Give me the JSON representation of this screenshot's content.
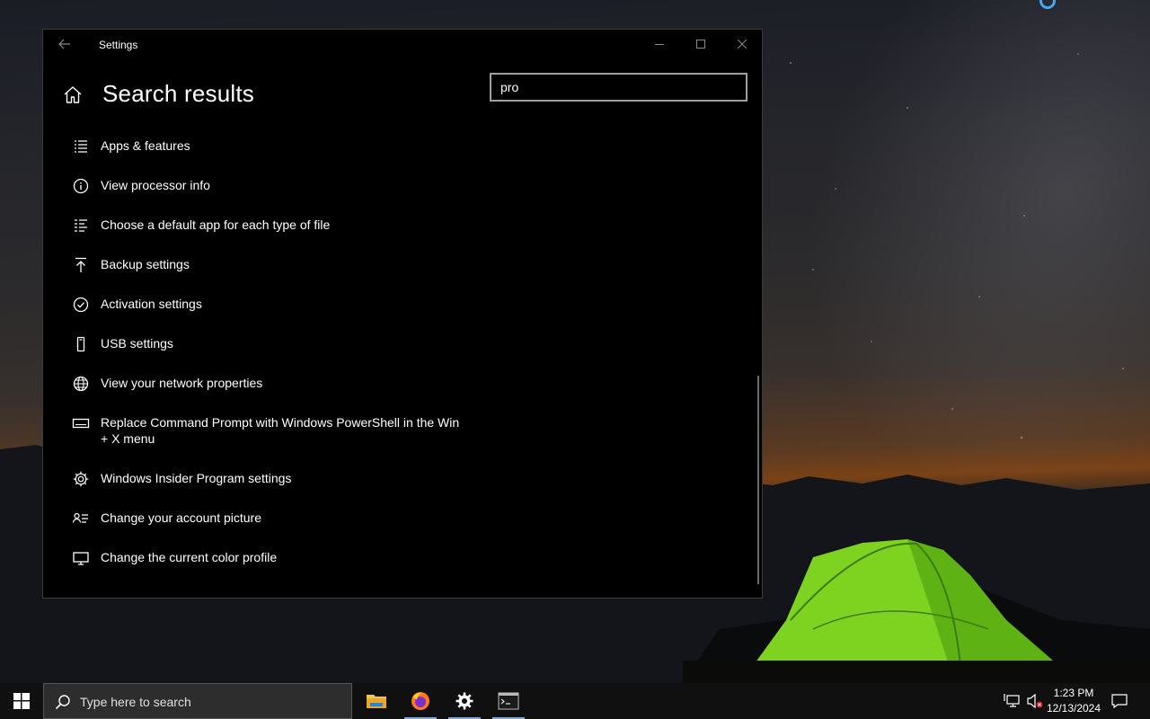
{
  "window": {
    "title": "Settings",
    "page_title": "Search results",
    "back_icon": "back-arrow-icon",
    "home_icon": "home-icon",
    "caption_buttons": [
      "minimize",
      "maximize",
      "close"
    ]
  },
  "search": {
    "value": "pro"
  },
  "results": [
    {
      "icon": "apps-list-icon",
      "label": "Apps & features"
    },
    {
      "icon": "info-icon",
      "label": "View processor info"
    },
    {
      "icon": "default-apps-icon",
      "label": "Choose a default app for each type of file"
    },
    {
      "icon": "backup-arrow-icon",
      "label": "Backup settings"
    },
    {
      "icon": "check-circle-icon",
      "label": "Activation settings"
    },
    {
      "icon": "usb-icon",
      "label": "USB settings"
    },
    {
      "icon": "globe-network-icon",
      "label": "View your network properties"
    },
    {
      "icon": "keyboard-icon",
      "label": "Replace Command Prompt with Windows PowerShell in the Win + X menu"
    },
    {
      "icon": "gear-icon",
      "label": "Windows Insider Program settings"
    },
    {
      "icon": "account-card-icon",
      "label": "Change your account picture"
    },
    {
      "icon": "monitor-icon",
      "label": "Change the current color profile"
    }
  ],
  "taskbar": {
    "search_placeholder": "Type here to search",
    "apps": [
      {
        "name": "file-explorer",
        "icon": "folder-icon",
        "active": false
      },
      {
        "name": "firefox",
        "icon": "firefox-icon",
        "active": true
      },
      {
        "name": "settings",
        "icon": "gear-icon",
        "active": true
      },
      {
        "name": "terminal",
        "icon": "terminal-icon",
        "active": true
      }
    ],
    "clock": {
      "time": "1:23 PM",
      "date": "12/13/2024"
    }
  },
  "colors": {
    "window_bg": "#000000",
    "taskbar_bg": "#101010",
    "accent": "#7aa8d8",
    "tent_green": "#7ed321"
  }
}
